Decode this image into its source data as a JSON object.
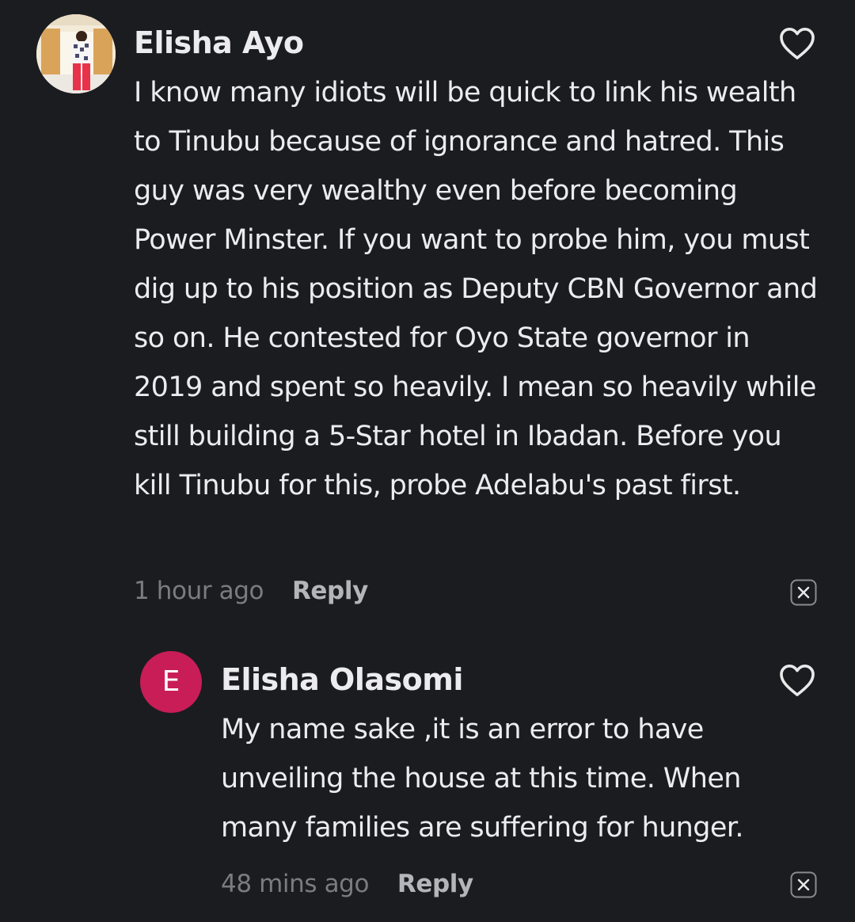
{
  "comments": [
    {
      "author": "Elisha Ayo",
      "text": "I know many idiots will be quick to link his wealth to Tinubu because of ignorance and hatred. This guy was very wealthy even before becoming Power Minster. If you want to probe him, you must dig up to his position as Deputy CBN Governor and so on. He contested for Oyo State governor in 2019 and spent so heavily. I mean so heavily while still building a 5-Star hotel in Ibadan. Before you kill Tinubu for this, probe Adelabu's past first.",
      "time": "1 hour ago",
      "reply_label": "Reply",
      "avatar_type": "photo"
    },
    {
      "author": "Elisha Olasomi",
      "avatar_letter": "E",
      "avatar_color": "#c81d57",
      "text": "My name sake ,it is an error to have unveiling the house at this time. When many families are suffering for hunger.",
      "time": "48 mins ago",
      "reply_label": "Reply"
    }
  ],
  "icons": {
    "like": "heart-outline-icon",
    "dismiss": "close-box-icon"
  },
  "colors": {
    "background": "#1b1c20",
    "text": "#ececee",
    "muted": "#7b7c82",
    "reply": "#b4b5ba"
  }
}
